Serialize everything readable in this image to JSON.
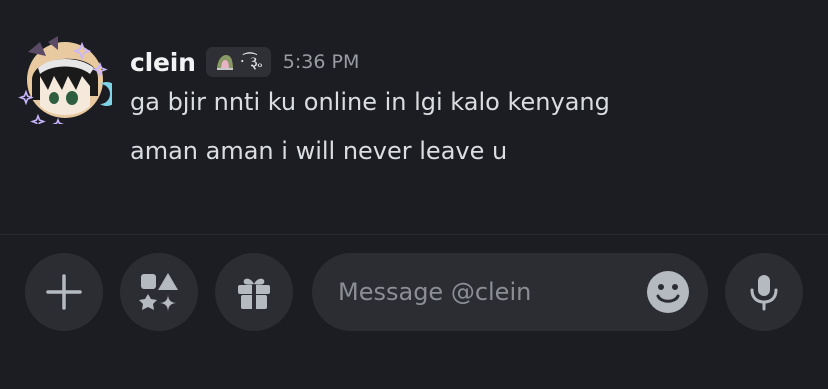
{
  "message": {
    "username": "clein",
    "tag_text": "‧ ͡૱",
    "timestamp": "5:36 PM",
    "lines": [
      "ga bjir nnti ku online in lgi kalo kenyang",
      "aman aman i will never leave u"
    ]
  },
  "composer": {
    "placeholder": "Message @clein",
    "buttons": {
      "add": "plus-icon",
      "apps": "apps-icon",
      "gift": "gift-icon",
      "emoji": "emoji-icon",
      "voice": "microphone-icon"
    }
  },
  "colors": {
    "background": "#1c1d22",
    "button_bg": "#2c2d33",
    "username": "#f2f3f5",
    "text": "#dbdee1",
    "muted": "#9a9ca4",
    "icon": "#b5bac1"
  }
}
